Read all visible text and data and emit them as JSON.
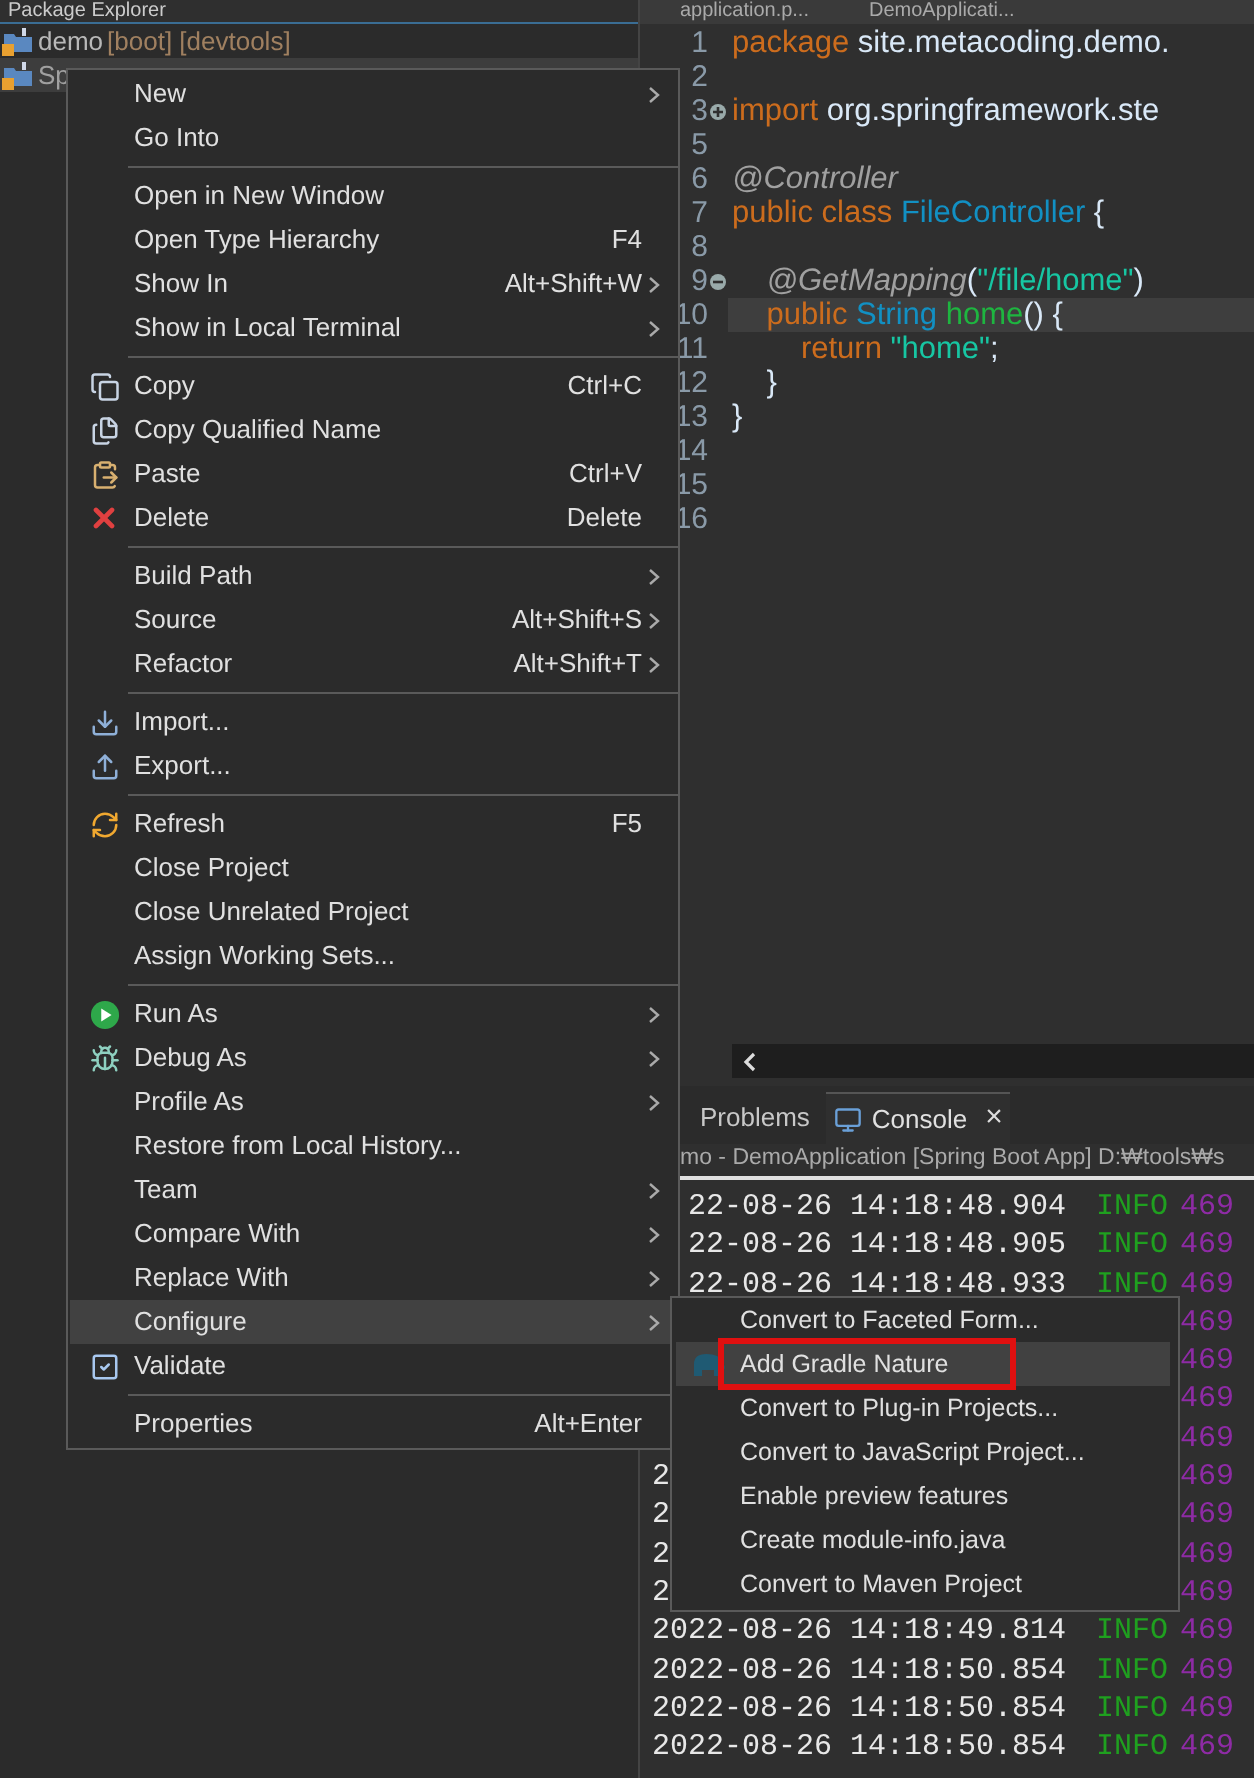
{
  "package_explorer": {
    "title": "Package Explorer",
    "rows": [
      {
        "label": "demo",
        "decorations": "[boot] [devtools]",
        "selected": false
      },
      {
        "label": "Sp",
        "selected": true
      }
    ]
  },
  "editor": {
    "tabs": [
      {
        "label": "application.p..."
      },
      {
        "label": "DemoApplicati..."
      }
    ],
    "lines": [
      {
        "number": "1",
        "current": false,
        "tokens": [
          {
            "text": "package",
            "kind": "keyword"
          },
          {
            "text": " site.metacoding.demo.",
            "kind": "plain"
          }
        ]
      },
      {
        "number": "2",
        "current": false
      },
      {
        "number": "3",
        "current": false,
        "collapsed": true,
        "tokens": [
          {
            "text": "import",
            "kind": "keyword"
          },
          {
            "text": " org.springframework.ste",
            "kind": "plain"
          }
        ]
      },
      {
        "number": "5",
        "current": false
      },
      {
        "number": "6",
        "current": false,
        "tokens": [
          {
            "text": "@Controller",
            "kind": "annotation"
          }
        ]
      },
      {
        "number": "7",
        "current": false,
        "tokens": [
          {
            "text": "public class ",
            "kind": "keyword"
          },
          {
            "text": "FileController",
            "kind": "type"
          },
          {
            "text": " {",
            "kind": "plain"
          }
        ]
      },
      {
        "number": "8",
        "current": false
      },
      {
        "number": "9",
        "current": false,
        "collapsed": false,
        "tokens": [
          {
            "text": "    @GetMapping",
            "kind": "annotation"
          },
          {
            "text": "(",
            "kind": "plain"
          },
          {
            "text": "\"/file/home\"",
            "kind": "string"
          },
          {
            "text": ")",
            "kind": "plain"
          }
        ]
      },
      {
        "number": "10",
        "current": true,
        "tokens": [
          {
            "text": "    public ",
            "kind": "keyword"
          },
          {
            "text": "String ",
            "kind": "type"
          },
          {
            "text": "home",
            "kind": "method"
          },
          {
            "text": "() {",
            "kind": "plain"
          }
        ]
      },
      {
        "number": "11",
        "current": false,
        "tokens": [
          {
            "text": "        return ",
            "kind": "keyword"
          },
          {
            "text": "\"home\"",
            "kind": "string"
          },
          {
            "text": ";",
            "kind": "plain"
          }
        ]
      },
      {
        "number": "12",
        "current": false,
        "tokens": [
          {
            "text": "    }",
            "kind": "plain"
          }
        ]
      },
      {
        "number": "13",
        "current": false,
        "tokens": [
          {
            "text": "}",
            "kind": "plain"
          }
        ]
      },
      {
        "number": "14",
        "current": false
      },
      {
        "number": "15",
        "current": false
      },
      {
        "number": "16",
        "current": false
      }
    ]
  },
  "bottom_panel": {
    "tabs": [
      {
        "label": "Problems",
        "selected": false
      },
      {
        "label": "Console",
        "selected": true,
        "close": "×"
      }
    ],
    "launch": "mo - DemoApplication [Spring Boot App] D:₩tools₩s",
    "rows": [
      {
        "time": "22-08-26 14:18:48.904",
        "cut": true,
        "level": "INFO",
        "pid": "469"
      },
      {
        "time": "22-08-26 14:18:48.905",
        "cut": true,
        "level": "INFO",
        "pid": "469"
      },
      {
        "time": "22-08-26 14:18:48.933",
        "cut": true,
        "level": "INFO",
        "pid": "469"
      },
      {
        "pid": "469"
      },
      {
        "pid": "469"
      },
      {
        "pid": "469"
      },
      {
        "pid": "469"
      },
      {
        "time": "2",
        "pid": "469"
      },
      {
        "time": "2",
        "pid": "469"
      },
      {
        "time": "2",
        "pid": "469"
      },
      {
        "time": "2",
        "pid": "469"
      },
      {
        "time": "2022-08-26 14:18:49.814",
        "level": "INFO",
        "pid": "469"
      },
      {
        "time": "2022-08-26 14:18:50.854",
        "level": "INFO",
        "pid": "469"
      },
      {
        "time": "2022-08-26 14:18:50.854",
        "level": "INFO",
        "pid": "469"
      },
      {
        "time": "2022-08-26 14:18:50.854",
        "level": "INFO",
        "pid": "469"
      }
    ]
  },
  "context_menu": {
    "items": [
      {
        "kind": "item",
        "label": "New",
        "submenu": true,
        "selected": false
      },
      {
        "kind": "item",
        "label": "Go Into",
        "submenu": false,
        "selected": false
      },
      {
        "kind": "separator"
      },
      {
        "kind": "item",
        "label": "Open in New Window",
        "submenu": false,
        "selected": false
      },
      {
        "kind": "item",
        "label": "Open Type Hierarchy",
        "shortcut": "F4",
        "submenu": false,
        "selected": false
      },
      {
        "kind": "item",
        "label": "Show In",
        "shortcut": "Alt+Shift+W",
        "submenu": true,
        "selected": false
      },
      {
        "kind": "item",
        "label": "Show in Local Terminal",
        "submenu": true,
        "selected": false
      },
      {
        "kind": "separator"
      },
      {
        "kind": "item",
        "label": "Copy",
        "shortcut": "Ctrl+C",
        "submenu": false,
        "selected": false
      },
      {
        "kind": "item",
        "label": "Copy Qualified Name",
        "submenu": false,
        "selected": false
      },
      {
        "kind": "item",
        "label": "Paste",
        "shortcut": "Ctrl+V",
        "submenu": false,
        "selected": false
      },
      {
        "kind": "item",
        "label": "Delete",
        "shortcut": "Delete",
        "submenu": false,
        "selected": false
      },
      {
        "kind": "separator"
      },
      {
        "kind": "item",
        "label": "Build Path",
        "submenu": true,
        "selected": false
      },
      {
        "kind": "item",
        "label": "Source",
        "shortcut": "Alt+Shift+S",
        "submenu": true,
        "selected": false
      },
      {
        "kind": "item",
        "label": "Refactor",
        "shortcut": "Alt+Shift+T",
        "submenu": true,
        "selected": false
      },
      {
        "kind": "separator"
      },
      {
        "kind": "item",
        "label": "Import...",
        "submenu": false,
        "selected": false
      },
      {
        "kind": "item",
        "label": "Export...",
        "submenu": false,
        "selected": false
      },
      {
        "kind": "separator"
      },
      {
        "kind": "item",
        "label": "Refresh",
        "shortcut": "F5",
        "submenu": false,
        "selected": false
      },
      {
        "kind": "item",
        "label": "Close Project",
        "submenu": false,
        "selected": false
      },
      {
        "kind": "item",
        "label": "Close Unrelated Project",
        "submenu": false,
        "selected": false
      },
      {
        "kind": "item",
        "label": "Assign Working Sets...",
        "submenu": false,
        "selected": false
      },
      {
        "kind": "separator"
      },
      {
        "kind": "item",
        "label": "Run As",
        "submenu": true,
        "selected": false
      },
      {
        "kind": "item",
        "label": "Debug As",
        "submenu": true,
        "selected": false
      },
      {
        "kind": "item",
        "label": "Profile As",
        "submenu": true,
        "selected": false
      },
      {
        "kind": "item",
        "label": "Restore from Local History...",
        "submenu": false,
        "selected": false
      },
      {
        "kind": "item",
        "label": "Team",
        "submenu": true,
        "selected": false
      },
      {
        "kind": "item",
        "label": "Compare With",
        "submenu": true,
        "selected": false
      },
      {
        "kind": "item",
        "label": "Replace With",
        "submenu": true,
        "selected": false
      },
      {
        "kind": "item",
        "label": "Configure",
        "submenu": true,
        "selected": true
      },
      {
        "kind": "item",
        "label": "Validate",
        "submenu": false,
        "selected": false
      },
      {
        "kind": "separator"
      },
      {
        "kind": "item",
        "label": "Properties",
        "shortcut": "Alt+Enter",
        "submenu": false,
        "selected": false
      }
    ]
  },
  "configure_submenu": {
    "items": [
      {
        "label": "Convert to Faceted Form...",
        "selected": false,
        "annotated": false
      },
      {
        "label": "Add Gradle Nature",
        "selected": true,
        "annotated": true
      },
      {
        "label": "Convert to Plug-in Projects...",
        "selected": false,
        "annotated": false
      },
      {
        "label": "Convert to JavaScript Project...",
        "selected": false,
        "annotated": false
      },
      {
        "label": "Enable preview features",
        "selected": false,
        "annotated": false
      },
      {
        "label": "Create module-info.java",
        "selected": false,
        "annotated": false
      },
      {
        "label": "Convert to Maven Project",
        "selected": false,
        "annotated": false
      }
    ]
  }
}
